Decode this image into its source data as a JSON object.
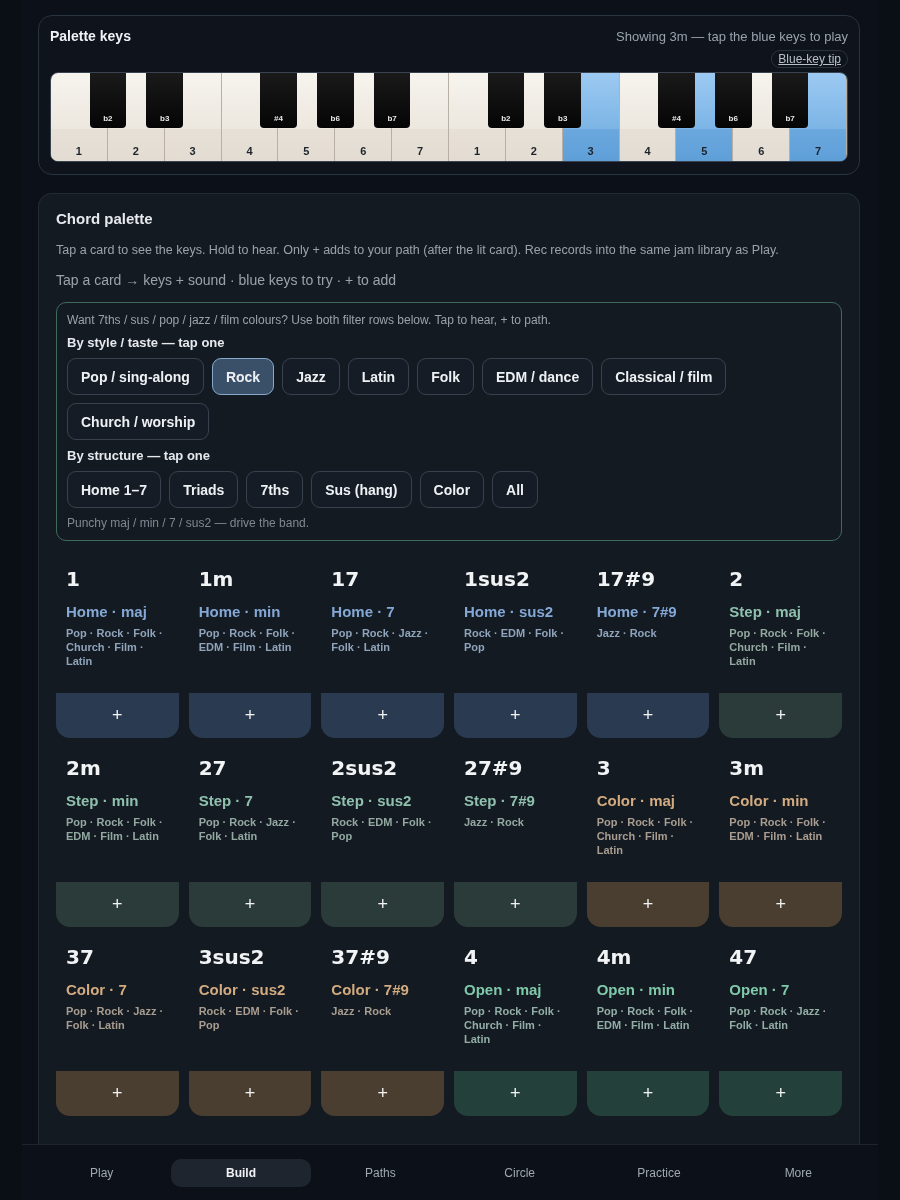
{
  "palette_keys": {
    "title": "Palette keys",
    "status": "Showing 3m — tap the blue keys to play",
    "tip_link": "Blue-key tip",
    "white_keys": [
      {
        "label": "1",
        "lit": false,
        "sharp": "b2"
      },
      {
        "label": "2",
        "lit": false,
        "sharp": "b3"
      },
      {
        "label": "3",
        "lit": false
      },
      {
        "label": "4",
        "lit": false,
        "sharp": "#4"
      },
      {
        "label": "5",
        "lit": false,
        "sharp": "b6"
      },
      {
        "label": "6",
        "lit": false,
        "sharp": "b7"
      },
      {
        "label": "7",
        "lit": false
      },
      {
        "label": "1",
        "lit": false,
        "sharp": "b2"
      },
      {
        "label": "2",
        "lit": false,
        "sharp": "b3"
      },
      {
        "label": "3",
        "lit": true
      },
      {
        "label": "4",
        "lit": false,
        "sharp": "#4"
      },
      {
        "label": "5",
        "lit": true,
        "sharp": "b6"
      },
      {
        "label": "6",
        "lit": false,
        "sharp": "b7"
      },
      {
        "label": "7",
        "lit": true
      }
    ]
  },
  "chord_palette": {
    "title": "Chord palette",
    "description": "Tap a card to see the keys. Hold to hear. Only + adds to your path (after the lit card). Rec records into the same jam library as Play.",
    "hint": "Tap a card → keys + sound · blue keys to try · + to add",
    "filters": {
      "intro": "Want 7ths / sus / pop / jazz / film colours? Use both filter rows below. Tap to hear, + to path.",
      "style_label": "By style / taste — tap one",
      "style_chips": [
        {
          "label": "Pop / sing-along",
          "selected": false
        },
        {
          "label": "Rock",
          "selected": true
        },
        {
          "label": "Jazz",
          "selected": false
        },
        {
          "label": "Latin",
          "selected": false
        },
        {
          "label": "Folk",
          "selected": false
        },
        {
          "label": "EDM / dance",
          "selected": false
        },
        {
          "label": "Classical / film",
          "selected": false
        },
        {
          "label": "Church / worship",
          "selected": false
        }
      ],
      "structure_label": "By structure — tap one",
      "structure_chips": [
        {
          "label": "Home 1–7",
          "selected": false
        },
        {
          "label": "Triads",
          "selected": false
        },
        {
          "label": "7ths",
          "selected": false
        },
        {
          "label": "Sus (hang)",
          "selected": false
        },
        {
          "label": "Color",
          "selected": false
        },
        {
          "label": "All",
          "selected": false
        }
      ],
      "note": "Punchy maj / min / 7 / sus2 — drive the band."
    },
    "cards": [
      {
        "kind": "home",
        "name": "1",
        "role": "Home · maj",
        "genres": "Pop · Rock · Folk · Church · Film · Latin",
        "add": "+"
      },
      {
        "kind": "home",
        "name": "1m",
        "role": "Home · min",
        "genres": "Pop · Rock · Folk · EDM · Film · Latin",
        "add": "+"
      },
      {
        "kind": "home",
        "name": "17",
        "role": "Home · 7",
        "genres": "Pop · Rock · Jazz · Folk · Latin",
        "add": "+"
      },
      {
        "kind": "home",
        "name": "1sus2",
        "role": "Home · sus2",
        "genres": "Rock · EDM · Folk · Pop",
        "add": "+"
      },
      {
        "kind": "home",
        "name": "17#9",
        "role": "Home · 7#9",
        "genres": "Jazz · Rock",
        "add": "+"
      },
      {
        "kind": "step",
        "name": "2",
        "role": "Step · maj",
        "genres": "Pop · Rock · Folk · Church · Film · Latin",
        "add": "+"
      },
      {
        "kind": "step",
        "name": "2m",
        "role": "Step · min",
        "genres": "Pop · Rock · Folk · EDM · Film · Latin",
        "add": "+"
      },
      {
        "kind": "step",
        "name": "27",
        "role": "Step · 7",
        "genres": "Pop · Rock · Jazz · Folk · Latin",
        "add": "+"
      },
      {
        "kind": "step",
        "name": "2sus2",
        "role": "Step · sus2",
        "genres": "Rock · EDM · Folk · Pop",
        "add": "+"
      },
      {
        "kind": "step",
        "name": "27#9",
        "role": "Step · 7#9",
        "genres": "Jazz · Rock",
        "add": "+"
      },
      {
        "kind": "color",
        "name": "3",
        "role": "Color · maj",
        "genres": "Pop · Rock · Folk · Church · Film · Latin",
        "add": "+"
      },
      {
        "kind": "color",
        "name": "3m",
        "role": "Color · min",
        "genres": "Pop · Rock · Folk · EDM · Film · Latin",
        "add": "+"
      },
      {
        "kind": "color",
        "name": "37",
        "role": "Color · 7",
        "genres": "Pop · Rock · Jazz · Folk · Latin",
        "add": "+"
      },
      {
        "kind": "color",
        "name": "3sus2",
        "role": "Color · sus2",
        "genres": "Rock · EDM · Folk · Pop",
        "add": "+"
      },
      {
        "kind": "color",
        "name": "37#9",
        "role": "Color · 7#9",
        "genres": "Jazz · Rock",
        "add": "+"
      },
      {
        "kind": "open",
        "name": "4",
        "role": "Open · maj",
        "genres": "Pop · Rock · Folk · Church · Film · Latin",
        "add": "+"
      },
      {
        "kind": "open",
        "name": "4m",
        "role": "Open · min",
        "genres": "Pop · Rock · Folk · EDM · Film · Latin",
        "add": "+"
      },
      {
        "kind": "open",
        "name": "47",
        "role": "Open · 7",
        "genres": "Pop · Rock · Jazz · Folk · Latin",
        "add": "+"
      }
    ]
  },
  "bottom_nav": [
    {
      "label": "Play",
      "selected": false
    },
    {
      "label": "Build",
      "selected": true
    },
    {
      "label": "Paths",
      "selected": false
    },
    {
      "label": "Circle",
      "selected": false
    },
    {
      "label": "Practice",
      "selected": false
    },
    {
      "label": "More",
      "selected": false
    }
  ]
}
